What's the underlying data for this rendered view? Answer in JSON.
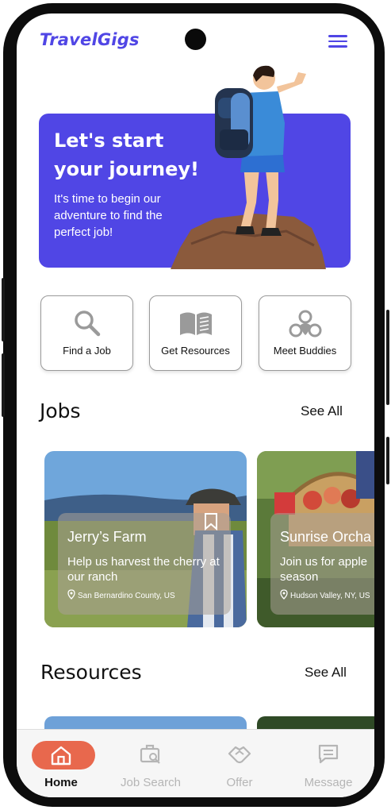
{
  "app": {
    "logo": "TravelGigs"
  },
  "hero": {
    "title": "Let's start your journey!",
    "subtitle": "It's time to begin our adventure to find the perfect job!"
  },
  "categories": [
    {
      "label": "Find a Job",
      "icon": "search-icon"
    },
    {
      "label": "Get Resources",
      "icon": "book-icon"
    },
    {
      "label": "Meet Buddies",
      "icon": "buddies-icon"
    }
  ],
  "jobs_section": {
    "title": "Jobs",
    "see_all": "See All",
    "items": [
      {
        "title": "Jerry’s Farm",
        "description": "Help us harvest the cherry at our ranch",
        "location": "San Bernardino County, US"
      },
      {
        "title": "Sunrise Orcha",
        "description": "Join us for apple season",
        "location": "Hudson Valley, NY, US"
      }
    ]
  },
  "resources_section": {
    "title": "Resources",
    "see_all": "See All"
  },
  "tabbar": {
    "active": "Home",
    "items": [
      {
        "label": "Home",
        "icon": "home-icon"
      },
      {
        "label": "Job Search",
        "icon": "job-search-icon"
      },
      {
        "label": "Offer",
        "icon": "handshake-icon"
      },
      {
        "label": "Message",
        "icon": "message-icon"
      }
    ]
  },
  "colors": {
    "brand": "#5046e5",
    "active_tab": "#e8684d"
  }
}
